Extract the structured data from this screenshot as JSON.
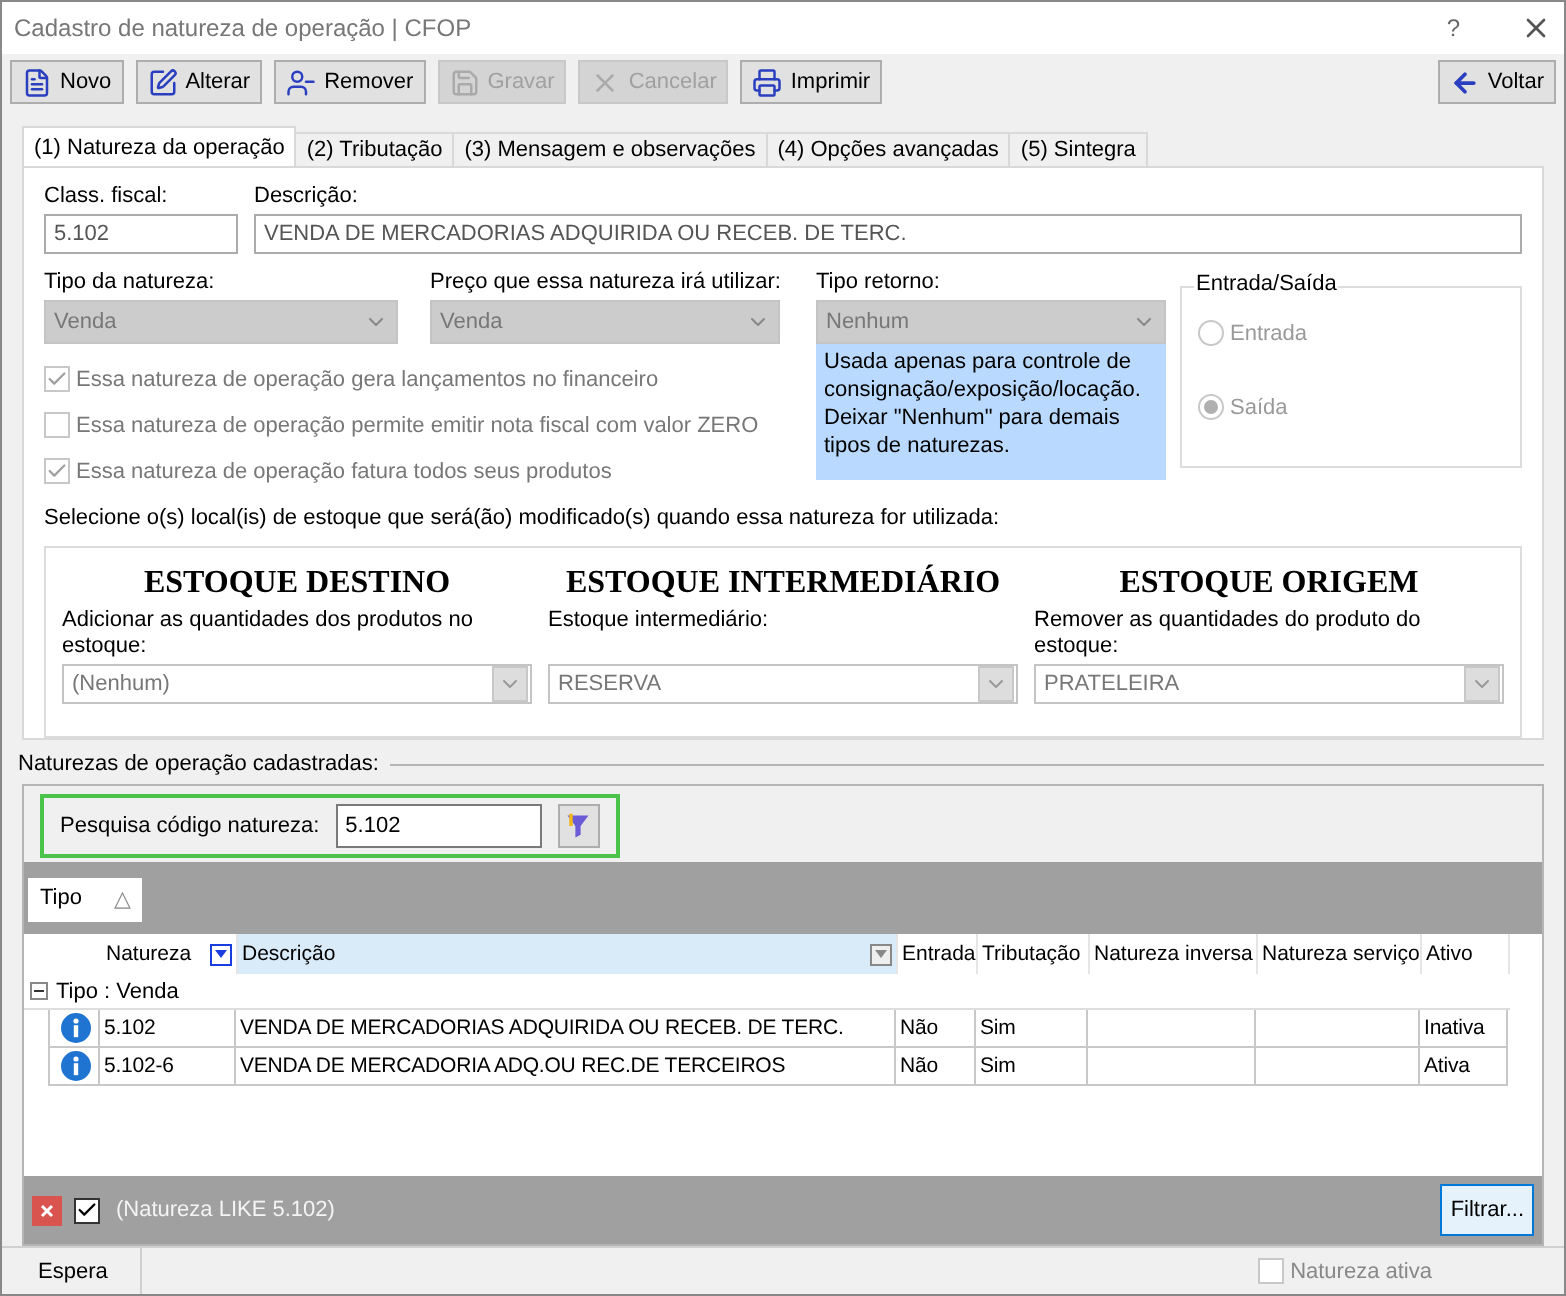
{
  "window": {
    "title": "Cadastro de natureza de operação | CFOP",
    "help": "?"
  },
  "toolbar": [
    {
      "label": "Novo",
      "disabled": false
    },
    {
      "label": "Alterar",
      "disabled": false
    },
    {
      "label": "Remover",
      "disabled": false
    },
    {
      "label": "Gravar",
      "disabled": true
    },
    {
      "label": "Cancelar",
      "disabled": true
    },
    {
      "label": "Imprimir",
      "disabled": false
    }
  ],
  "back_button": {
    "label": "Voltar"
  },
  "tabs": [
    {
      "label": "(1) Natureza da operação",
      "selected": true
    },
    {
      "label": "(2) Tributação",
      "selected": false
    },
    {
      "label": "(3) Mensagem e observações",
      "selected": false
    },
    {
      "label": "(4) Opções avançadas",
      "selected": false
    },
    {
      "label": "(5) Sintegra",
      "selected": false
    }
  ],
  "form": {
    "class_fiscal": {
      "label": "Class. fiscal:",
      "value": "5.102"
    },
    "descricao": {
      "label": "Descrição:",
      "value": "VENDA DE MERCADORIAS ADQUIRIDA OU RECEB. DE TERC."
    },
    "tipo_natureza": {
      "label": "Tipo da natureza:",
      "value": "Venda"
    },
    "preco": {
      "label": "Preço que essa natureza irá utilizar:",
      "value": "Venda"
    },
    "tipo_retorno": {
      "label": "Tipo retorno:",
      "value": "Nenhum"
    },
    "note": "Usada apenas para controle de consignação/exposição/locação. Deixar \"Nenhum\" para demais tipos de naturezas.",
    "entrada_saida": {
      "title": "Entrada/Saída",
      "options": [
        {
          "label": "Entrada",
          "selected": false
        },
        {
          "label": "Saída",
          "selected": true
        }
      ]
    },
    "checkboxes": [
      {
        "label": "Essa natureza de operação gera lançamentos no financeiro",
        "checked": true
      },
      {
        "label": "Essa natureza de operação permite emitir nota fiscal com valor ZERO",
        "checked": false
      },
      {
        "label": "Essa natureza de operação fatura todos seus produtos",
        "checked": true
      }
    ],
    "estoque": {
      "label": "Selecione o(s) local(is) de estoque que será(ão) modificado(s) quando essa natureza for utilizada:",
      "columns": [
        {
          "title": "ESTOQUE DESTINO",
          "label": "Adicionar as quantidades dos produtos no estoque:",
          "value": "(Nenhum)"
        },
        {
          "title": "ESTOQUE INTERMEDIÁRIO",
          "label": "Estoque intermediário:",
          "value": "RESERVA"
        },
        {
          "title": "ESTOQUE ORIGEM",
          "label": "Remover as quantidades do produto do estoque:",
          "value": "PRATELEIRA"
        }
      ]
    }
  },
  "list_section": {
    "title": "Naturezas de operação cadastradas:",
    "search": {
      "label": "Pesquisa código natureza:",
      "value": "5.102"
    },
    "group_by": {
      "label": "Tipo",
      "glyph": "△"
    },
    "columns": [
      {
        "label": "Natureza",
        "filtered": true,
        "selected": false
      },
      {
        "label": "Descrição",
        "filtered": false,
        "selected": true
      },
      {
        "label": "Entrada",
        "filtered": false,
        "selected": false
      },
      {
        "label": "Tributação",
        "filtered": false,
        "selected": false
      },
      {
        "label": "Natureza inversa",
        "filtered": false,
        "selected": false
      },
      {
        "label": "Natureza serviço",
        "filtered": false,
        "selected": false
      },
      {
        "label": "Ativo",
        "filtered": false,
        "selected": false
      }
    ],
    "group": {
      "label": "Tipo : Venda",
      "expanded": true
    },
    "rows": [
      {
        "cells": [
          "5.102",
          "VENDA DE MERCADORIAS ADQUIRIDA OU RECEB. DE TERC.",
          "Não",
          "Sim",
          "",
          "",
          "Inativa"
        ]
      },
      {
        "cells": [
          "5.102-6",
          "VENDA DE MERCADORIA ADQ.OU REC.DE TERCEIROS",
          "Não",
          "Sim",
          "",
          "",
          "Ativa"
        ]
      }
    ],
    "filter": {
      "text": "(Natureza LIKE 5.102)",
      "enabled": true
    },
    "filter_button": "Filtrar..."
  },
  "status_bar": {
    "text": "Espera",
    "natureza_ativa": {
      "label": "Natureza ativa",
      "checked": false
    }
  }
}
